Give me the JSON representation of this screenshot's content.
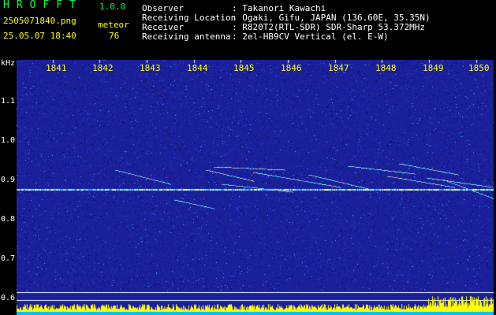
{
  "header": {
    "app_title": "HROFFT",
    "version": "1.0.0",
    "filename": "2505071840.png",
    "datetime": "25.05.07 18:40",
    "meteor_label": "meteor",
    "meteor_count": "76",
    "info": [
      {
        "label": "Observer",
        "value": ": Takanori Kawachi"
      },
      {
        "label": "Receiving Location",
        "value": ": Ogaki, Gifu, JAPAN (136.60E, 35.35N)"
      },
      {
        "label": "Receiver",
        "value": ": R820T2(RTL-SDR) SDR-Sharp 53.372MHz"
      },
      {
        "label": "Receiving antenna",
        "value": ": 2el-HB9CV Vertical (el. E-W)"
      }
    ]
  },
  "spectrogram": {
    "y_unit": "kHz",
    "y_ticks": [
      "1.1",
      "1.0",
      "0.9",
      "0.8",
      "0.7",
      "0.6"
    ],
    "x_ticks": [
      "1841",
      "1842",
      "1843",
      "1844",
      "1845",
      "1846",
      "1847",
      "1848",
      "1849",
      "1850"
    ],
    "background_color": "#1a1f9a",
    "carrier_color": "#ffffff",
    "trail_color": "#80ffe0",
    "level_bar_color": "#ffff00",
    "level_base_color": "#00bfff"
  }
}
